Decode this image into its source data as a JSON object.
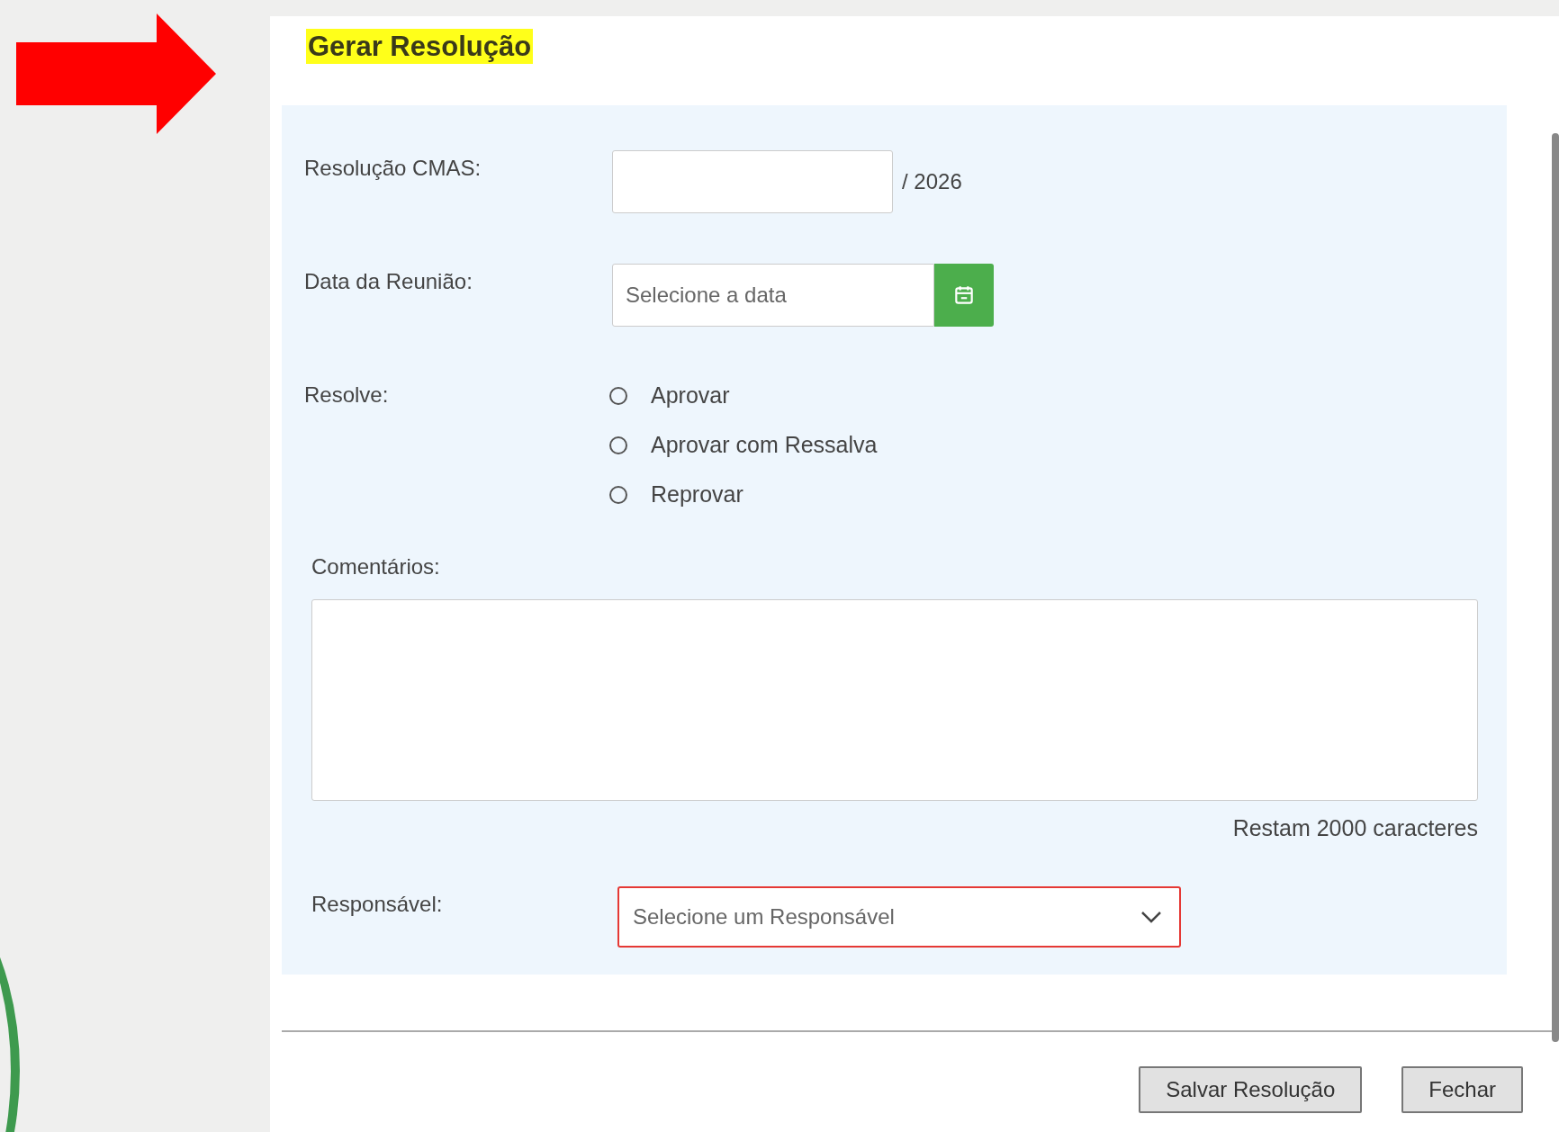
{
  "dialog": {
    "title": "Gerar Resolução"
  },
  "form": {
    "resolution": {
      "label": "Resolução CMAS:",
      "suffix": "/ 2026"
    },
    "meeting_date": {
      "label": "Data da Reunião:",
      "placeholder": "Selecione a data"
    },
    "resolve": {
      "label": "Resolve:",
      "options": [
        {
          "label": "Aprovar",
          "selected": false
        },
        {
          "label": "Aprovar com Ressalva",
          "selected": false
        },
        {
          "label": "Reprovar",
          "selected": false
        }
      ]
    },
    "comments": {
      "label": "Comentários:",
      "counter": "Restam 2000 caracteres"
    },
    "responsible": {
      "label": "Responsável:",
      "placeholder": "Selecione um Responsável",
      "invalid": true
    }
  },
  "buttons": [
    {
      "label": "Salvar Resolução"
    },
    {
      "label": "Fechar"
    }
  ]
}
